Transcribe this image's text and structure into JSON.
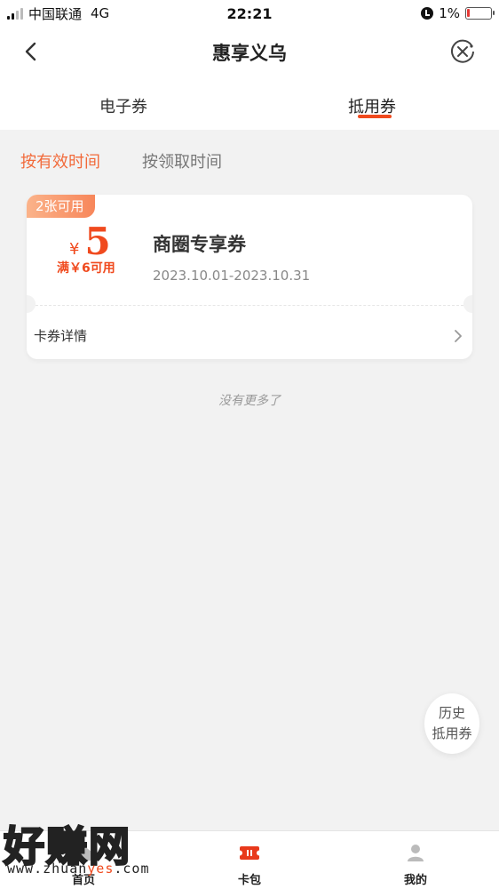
{
  "status_bar": {
    "carrier": "中国联通",
    "network": "4G",
    "time": "22:21",
    "battery": "1%"
  },
  "nav": {
    "title": "惠享义乌"
  },
  "tabs": [
    {
      "label": "电子券",
      "active": false
    },
    {
      "label": "抵用券",
      "active": true
    }
  ],
  "sort": {
    "by_valid_time": "按有效时间",
    "by_receive_time": "按领取时间"
  },
  "coupons": [
    {
      "badge": "2张可用",
      "currency": "¥",
      "amount": "5",
      "threshold": "满￥6可用",
      "name": "商圈专享券",
      "validity": "2023.10.01-2023.10.31",
      "detail_label": "卡券详情"
    }
  ],
  "no_more": "没有更多了",
  "history_button": {
    "line1": "历史",
    "line2": "抵用券"
  },
  "tab_bar": [
    {
      "label": "首页",
      "icon": "home-icon"
    },
    {
      "label": "卡包",
      "icon": "card-wallet-icon"
    },
    {
      "label": "我的",
      "icon": "user-icon"
    }
  ],
  "watermark": {
    "text": "好赚网",
    "url_prefix": "www.zhuan",
    "url_accent": "yes",
    "url_suffix": ".com"
  },
  "colors": {
    "accent": "#f04a1e",
    "sort_active": "#f26a3a",
    "background": "#f2f2f2"
  }
}
